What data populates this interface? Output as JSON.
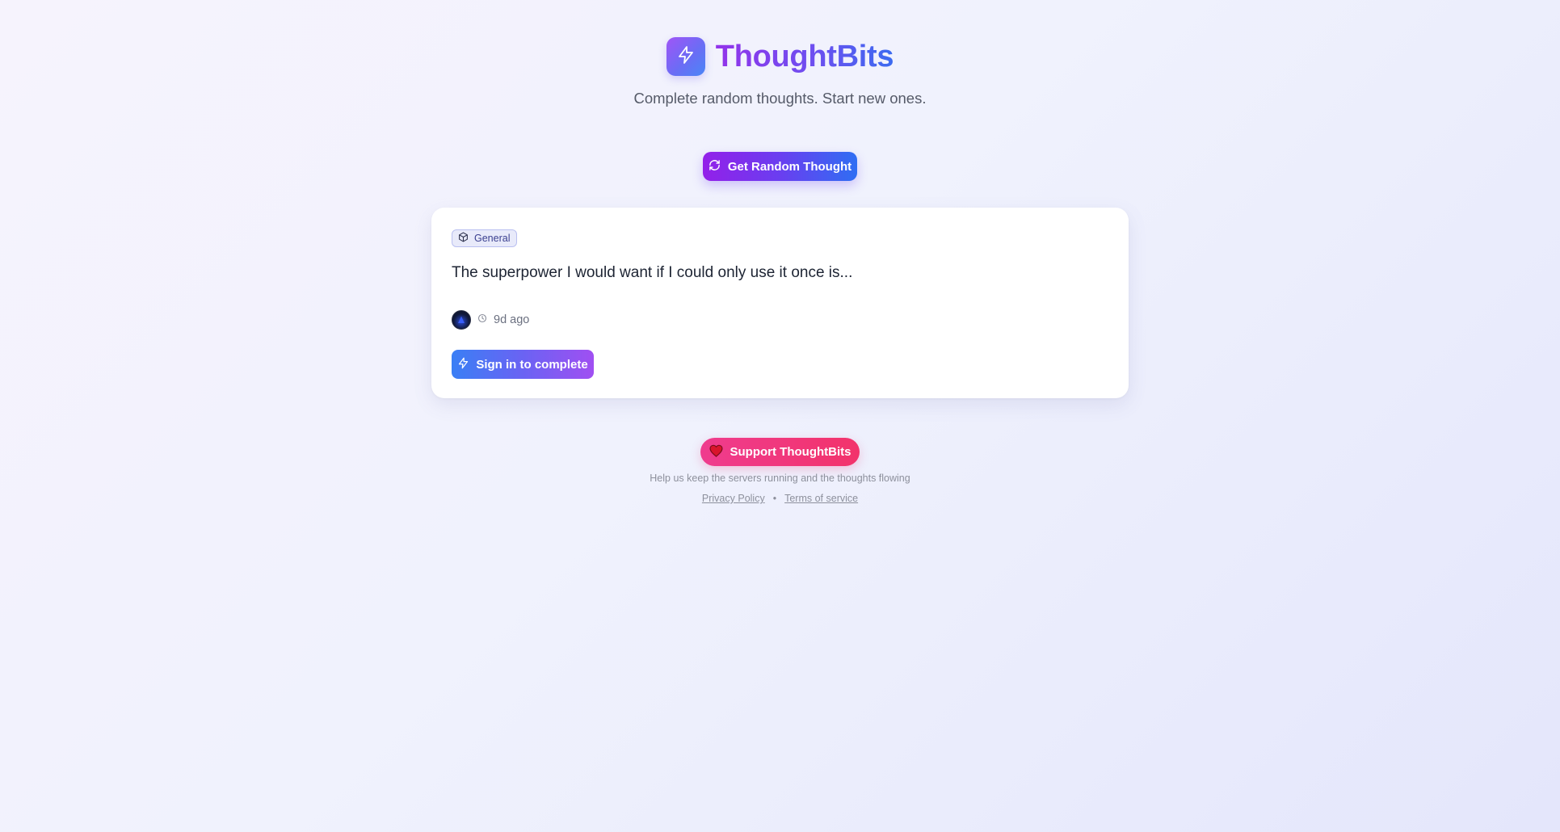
{
  "header": {
    "logo_icon": "lightning-bolt-icon",
    "title": "ThoughtBits",
    "tagline": "Complete random thoughts. Start new ones."
  },
  "random_button": {
    "icon": "refresh-icon",
    "label": "Get Random Thought"
  },
  "thought_card": {
    "category": {
      "icon": "cube-icon",
      "label": "General"
    },
    "prompt": "The superpower I would want if I could only use it once is...",
    "meta": {
      "avatar": "avatar",
      "time_icon": "clock-icon",
      "time_ago": "9d ago"
    },
    "action_button": {
      "icon": "lightning-bolt-icon",
      "label": "Sign in to complete"
    }
  },
  "footer": {
    "support_button": {
      "icon": "heart-icon",
      "label": "Support ThoughtBits"
    },
    "help_text": "Help us keep the servers running and the thoughts flowing",
    "links": [
      {
        "label": "Privacy Policy"
      },
      {
        "label": "Terms of service"
      }
    ],
    "separator": "•"
  },
  "colors": {
    "brand_purple": "#9333ea",
    "brand_blue": "#3b6bf0",
    "support_pink": "#ef3c8e",
    "tag_bg": "#e8eafa"
  }
}
